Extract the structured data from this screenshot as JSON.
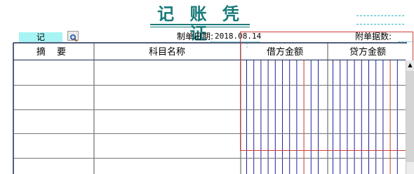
{
  "header": {
    "title": "记 账 凭 证",
    "voucher_type": "记",
    "date_label": "制单日期:",
    "date_value": "2018.08.14",
    "attachments_label": "附单据数:"
  },
  "table": {
    "columns": [
      "摘 要",
      "科目名称",
      "借方金额",
      "贷方金额"
    ],
    "rows": [
      {
        "summary": "",
        "subject": "",
        "debit": "",
        "credit": ""
      },
      {
        "summary": "",
        "subject": "",
        "debit": "",
        "credit": ""
      },
      {
        "summary": "",
        "subject": "",
        "debit": "",
        "credit": ""
      },
      {
        "summary": "",
        "subject": "",
        "debit": "",
        "credit": ""
      }
    ]
  },
  "scrollbar": {
    "up_arrow": "▲"
  },
  "colors": {
    "title": "#1a7a7a",
    "voucher_type_bg": "#a8f4f4",
    "dashed": "#33b3c6",
    "amount_lines_blue": "#2020a0",
    "amount_lines_red": "#cc3333",
    "selection_red": "#d04040",
    "grid_dark": "#1a2a55"
  }
}
